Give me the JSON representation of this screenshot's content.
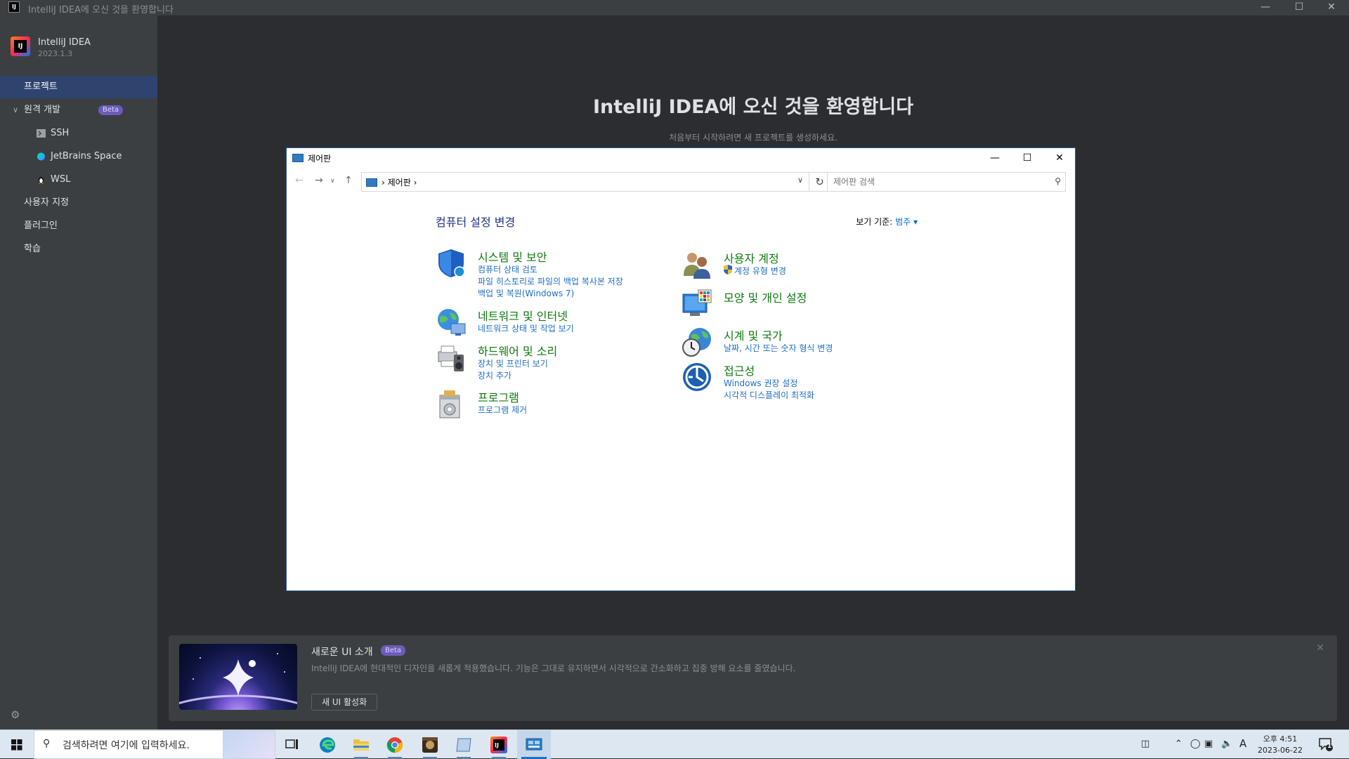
{
  "window": {
    "title": "IntelliJ IDEA에 오신 것을 환영합니다"
  },
  "app": {
    "name": "IntelliJ IDEA",
    "version": "2023.1.3"
  },
  "sidebar": {
    "items": [
      {
        "label": "프로젝트"
      },
      {
        "label": "원격 개발",
        "badge": "Beta"
      },
      {
        "label": "SSH"
      },
      {
        "label": "JetBrains Space"
      },
      {
        "label": "WSL"
      },
      {
        "label": "사용자 지정"
      },
      {
        "label": "플러그인"
      },
      {
        "label": "학습"
      }
    ]
  },
  "welcome": {
    "title": "IntelliJ IDEA에 오신 것을 환영합니다",
    "subtitle": "처음부터 시작하려면 새 프로젝트를 생성하세요."
  },
  "control_panel": {
    "title": "제어판",
    "breadcrumb": "제어판",
    "search_placeholder": "제어판 검색",
    "heading": "컴퓨터 설정 변경",
    "view_by_label": "보기 기준:",
    "view_by_value": "범주",
    "categories": [
      {
        "title": "시스템 및 보안",
        "links": [
          "컴퓨터 상태 검토",
          "파일 히스토리로 파일의 백업 복사본 저장",
          "백업 및 복원(Windows 7)"
        ]
      },
      {
        "title": "네트워크 및 인터넷",
        "links": [
          "네트워크 상태 및 작업 보기"
        ]
      },
      {
        "title": "하드웨어 및 소리",
        "links": [
          "장치 및 프린터 보기",
          "장치 추가"
        ]
      },
      {
        "title": "프로그램",
        "links": [
          "프로그램 제거"
        ]
      },
      {
        "title": "사용자 계정",
        "links": [
          "계정 유형 변경"
        ]
      },
      {
        "title": "모양 및 개인 설정",
        "links": []
      },
      {
        "title": "시계 및 국가",
        "links": [
          "날짜, 시간 또는 숫자 형식 변경"
        ]
      },
      {
        "title": "접근성",
        "links": [
          "Windows 권장 설정",
          "시각적 디스플레이 최적화"
        ]
      }
    ]
  },
  "banner": {
    "title": "새로운 UI 소개",
    "badge": "Beta",
    "description": "IntelliJ IDEA에 현대적인 디자인을 새롭게 적용했습니다. 기능은 그대로 유지하면서 시각적으로 간소화하고 집중 방해 요소를 줄였습니다.",
    "button": "새 UI 활성화"
  },
  "taskbar": {
    "search_placeholder": "검색하려면 여기에 입력하세요.",
    "ime": "A",
    "clock_time": "오후 4:51",
    "clock_date": "2023-06-22",
    "notification_count": "1"
  },
  "colors": {
    "accent": "#2e436e",
    "beta": "#6e5bb8",
    "cp_title_green": "#0e7a0e",
    "cp_link_blue": "#1e6dc4"
  }
}
